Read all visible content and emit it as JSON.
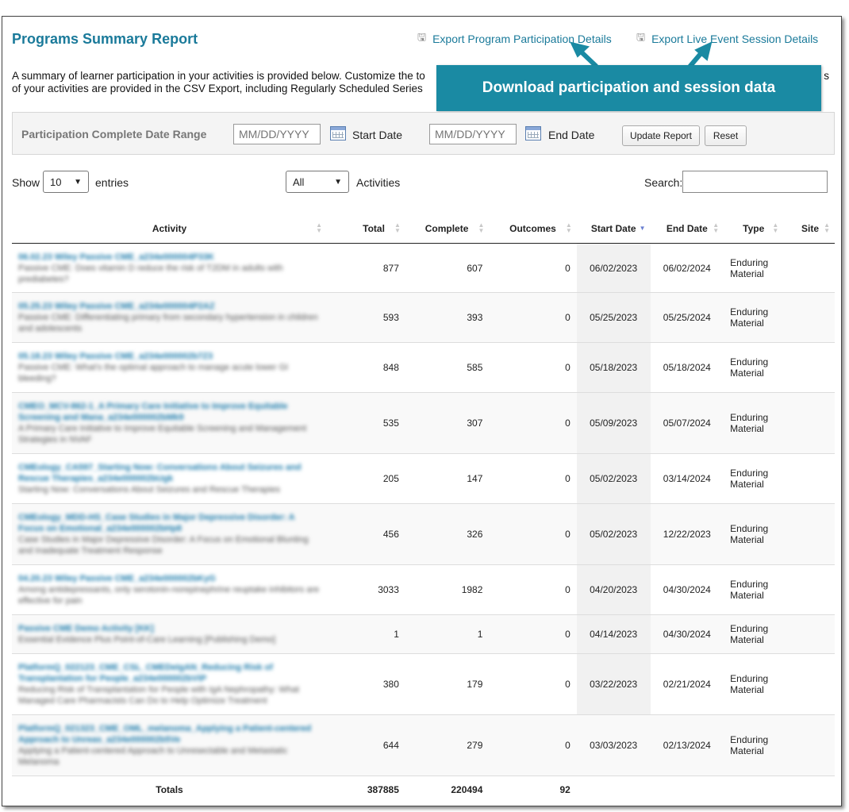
{
  "title": "Programs Summary Report",
  "exports": [
    {
      "label": "Export Program Participation Details",
      "icon": "download-icon"
    },
    {
      "label": "Export Live Event Session Details",
      "icon": "download-icon"
    }
  ],
  "description": {
    "line1": "A summary of learner participation in your activities is provided below. Customize the to",
    "line1_tail": "s",
    "line2": "of your activities are provided in the CSV Export, including Regularly Scheduled Series"
  },
  "callout": "Download participation and session data",
  "filter": {
    "label": "Participation Complete Date Range",
    "start_placeholder": "MM/DD/YYYY",
    "start_label": "Start Date",
    "end_placeholder": "MM/DD/YYYY",
    "end_label": "End Date",
    "update_button": "Update Report",
    "reset_button": "Reset"
  },
  "controls": {
    "show_label": "Show",
    "entries_value": "10",
    "entries_label": "entries",
    "activities_value": "All",
    "activities_label": "Activities",
    "search_label": "Search:"
  },
  "table": {
    "columns": [
      "Activity",
      "Total",
      "Complete",
      "Outcomes",
      "Start Date",
      "End Date",
      "Type",
      "Site"
    ],
    "sorted_column": "Start Date",
    "rows": [
      {
        "name": "06.02.23 Wiley Passive CME_a234e000004P33K",
        "desc": "Passive CME: Does vitamin D reduce the risk of T2DM in adults with prediabetes?",
        "total": "877",
        "complete": "607",
        "outcomes": "0",
        "start": "06/02/2023",
        "end": "06/02/2024",
        "type1": "Enduring",
        "type2": "Material"
      },
      {
        "name": "05.25.23 Wiley Passive CME_a234e000004P2AZ",
        "desc": "Passive CME: Differentiating primary from secondary hypertension in children and adolescents",
        "total": "593",
        "complete": "393",
        "outcomes": "0",
        "start": "05/25/2023",
        "end": "05/25/2024",
        "type1": "Enduring",
        "type2": "Material"
      },
      {
        "name": "05.18.23 Wiley Passive CME_a234e000002b7Z3",
        "desc": "Passive CME: What's the optimal approach to manage acute lower GI bleeding?",
        "total": "848",
        "complete": "585",
        "outcomes": "0",
        "start": "05/18/2023",
        "end": "05/18/2024",
        "type1": "Enduring",
        "type2": "Material"
      },
      {
        "name": "CMEO_MCV-862-1_A Primary Care Initiative to Improve Equitable Screening and Mana_a234e000002bMk9",
        "desc": "A Primary Care Initiative to Improve Equitable Screening and Management Strategies in NVAF",
        "total": "535",
        "complete": "307",
        "outcomes": "0",
        "start": "05/09/2023",
        "end": "05/07/2024",
        "type1": "Enduring",
        "type2": "Material"
      },
      {
        "name": "CMEology_CA597_Starting Now: Conversations About Seizures and Rescue Therapies_a234e000002bUgk",
        "desc": "Starting Now: Conversations About Seizures and Rescue Therapies",
        "total": "205",
        "complete": "147",
        "outcomes": "0",
        "start": "05/02/2023",
        "end": "03/14/2024",
        "type1": "Enduring",
        "type2": "Material"
      },
      {
        "name": "CMEology_MDD-HS_Case Studies in Major Depressive Disorder: A Focus on Emotional_a234e000002bHp8",
        "desc": "Case Studies in Major Depressive Disorder: A Focus on Emotional Blunting and Inadequate Treatment Response",
        "total": "456",
        "complete": "326",
        "outcomes": "0",
        "start": "05/02/2023",
        "end": "12/22/2023",
        "type1": "Enduring",
        "type2": "Material"
      },
      {
        "name": "04.20.23 Wiley Passive CME_a234e000002bKyG",
        "desc": "Among antidepressants, only serotonin-norepinephrine reuptake inhibitors are effective for pain",
        "total": "3033",
        "complete": "1982",
        "outcomes": "0",
        "start": "04/20/2023",
        "end": "04/30/2024",
        "type1": "Enduring",
        "type2": "Material"
      },
      {
        "name": "Passive CME Demo Activity [KK]",
        "desc": "Essential Evidence Plus Point-of-Care Learning [Publishing Demo]",
        "total": "1",
        "complete": "1",
        "outcomes": "0",
        "start": "04/14/2023",
        "end": "04/30/2024",
        "type1": "Enduring",
        "type2": "Material"
      },
      {
        "name": "PlatformQ_022123_CME_CSL_CMEDeIgAN_Reducing Risk of Transplantation for People_a234e000002bVtP",
        "desc": "Reducing Risk of Transplantation for People with IgA Nephropathy: What Managed Care Pharmacists Can Do to Help Optimize Treatment",
        "total": "380",
        "complete": "179",
        "outcomes": "0",
        "start": "03/22/2023",
        "end": "02/21/2024",
        "type1": "Enduring",
        "type2": "Material"
      },
      {
        "name": "PlatformQ_021323_CME_OML_melanoma_Applying a Patient-centered Approach to Unreas_a234e000002b5Ve",
        "desc": "Applying a Patient-centered Approach to Unresectable and Metastatic Melanoma",
        "total": "644",
        "complete": "279",
        "outcomes": "0",
        "start": "03/03/2023",
        "end": "02/13/2024",
        "type1": "Enduring",
        "type2": "Material"
      }
    ],
    "totals": {
      "label": "Totals",
      "total": "387885",
      "complete": "220494",
      "outcomes": "92"
    }
  },
  "colors": {
    "accent": "#1a7a9a",
    "callout_bg": "#1a8aa3"
  }
}
